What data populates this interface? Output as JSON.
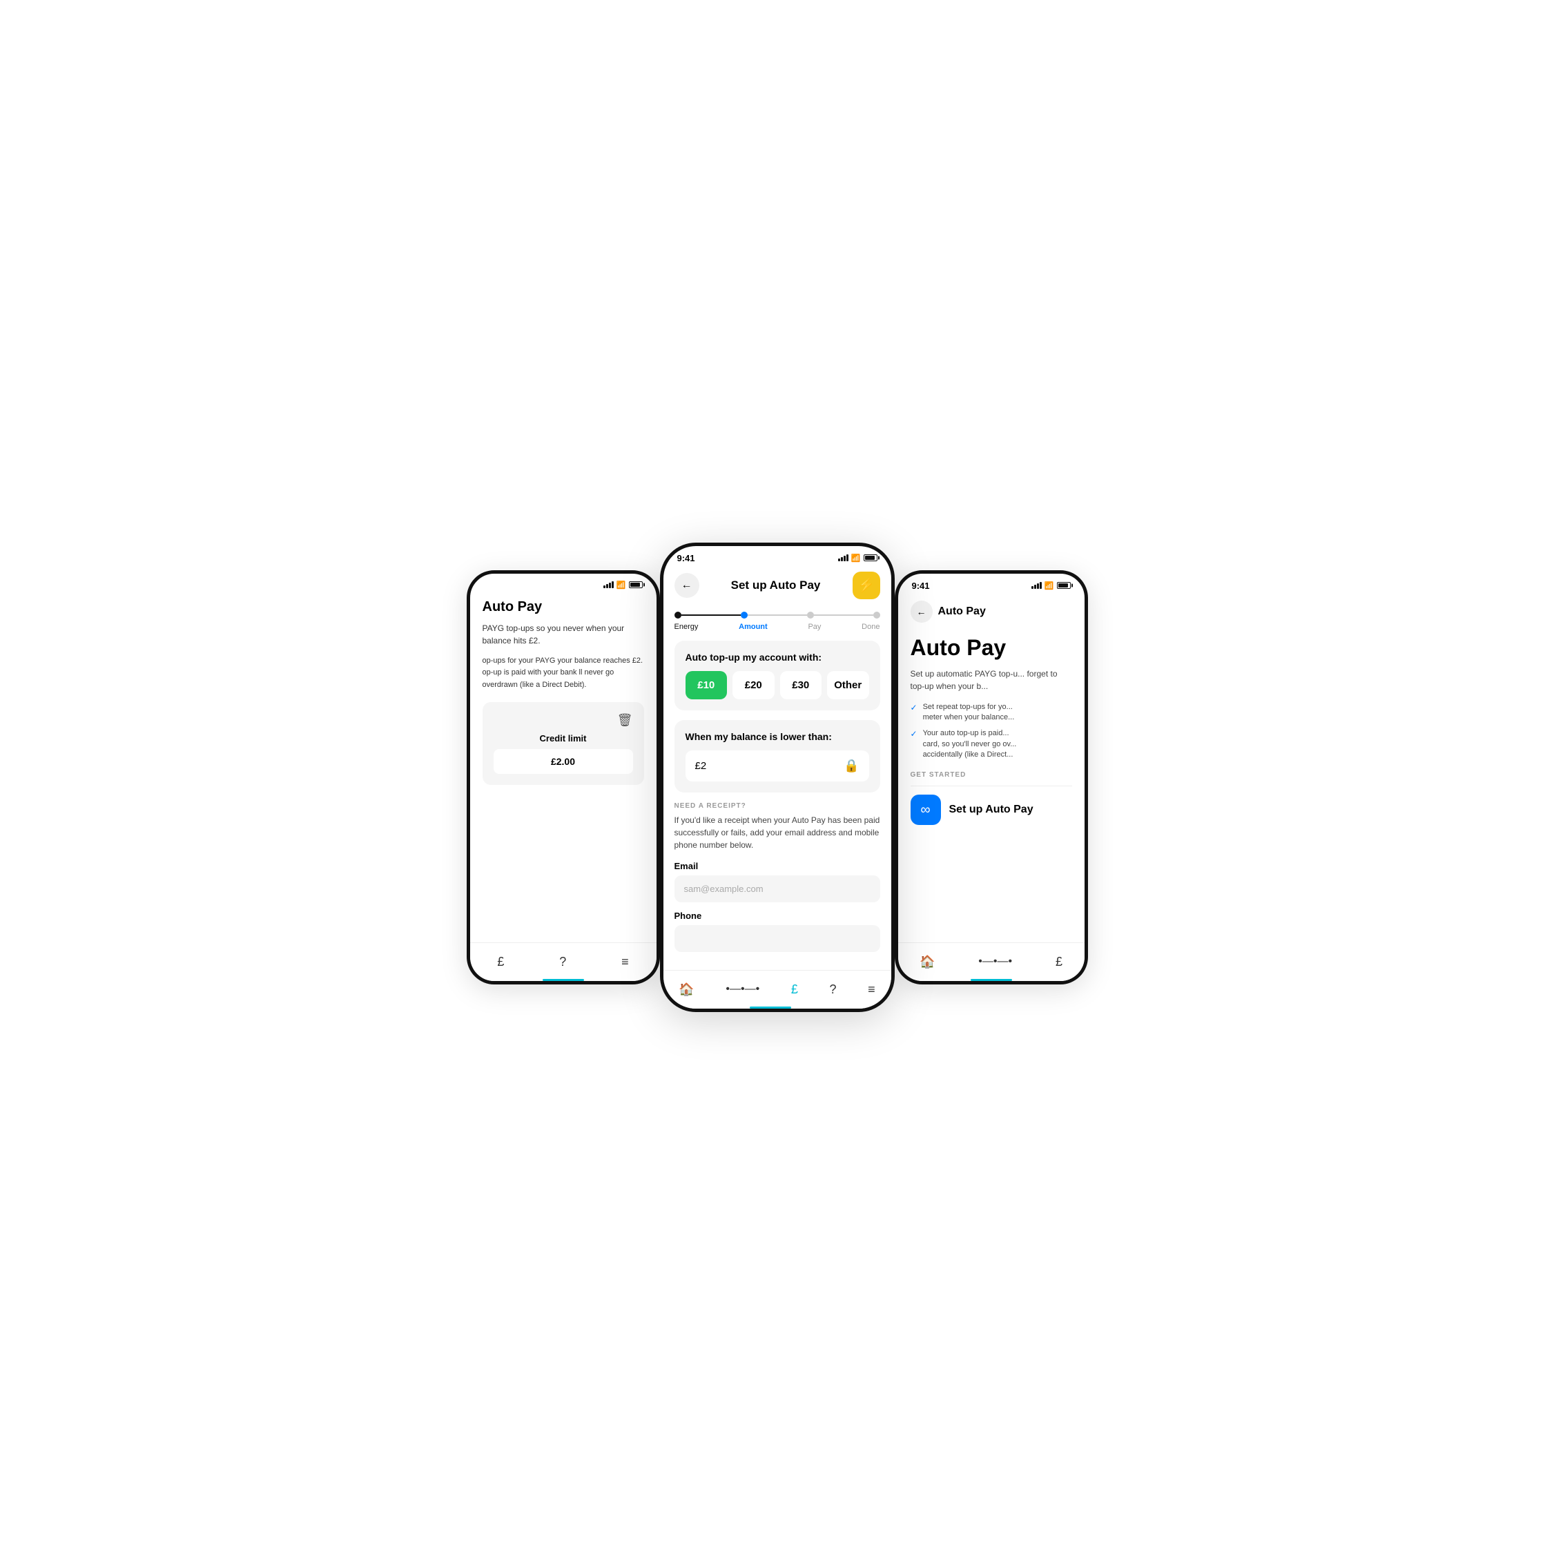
{
  "left": {
    "title": "Auto Pay",
    "desc": "PAYG top-ups so you never\nwhen your balance hits £2.",
    "bullets": "op-ups for your PAYG\nyour balance reaches £2.\n\nop-up is paid with your bank\nll never go overdrawn\n(like a Direct Debit).",
    "card": {
      "credit_label": "Credit limit",
      "credit_value": "£2.00"
    },
    "nav": [
      "£",
      "?",
      "≡"
    ]
  },
  "center": {
    "time": "9:41",
    "header": {
      "back_label": "←",
      "title": "Set up Auto Pay",
      "lightning": "⚡"
    },
    "steps": [
      {
        "label": "Energy",
        "state": "filled"
      },
      {
        "label": "Amount",
        "state": "active"
      },
      {
        "label": "Pay",
        "state": "default"
      },
      {
        "label": "Done",
        "state": "default"
      }
    ],
    "amount_section": {
      "title": "Auto top-up my account with:",
      "options": [
        {
          "label": "£10",
          "selected": true
        },
        {
          "label": "£20",
          "selected": false
        },
        {
          "label": "£30",
          "selected": false
        },
        {
          "label": "Other",
          "selected": false
        }
      ]
    },
    "balance_section": {
      "title": "When my balance is lower than:",
      "value": "£2",
      "lock_icon": "🔒"
    },
    "receipt_section": {
      "label": "NEED A RECEIPT?",
      "desc": "If you'd like a receipt when your Auto Pay has been paid successfully or fails, add your email address and mobile phone number below.",
      "email_label": "Email",
      "email_placeholder": "sam@example.com",
      "phone_label": "Phone"
    },
    "nav": [
      "🏠",
      "⋯",
      "£",
      "?",
      "≡"
    ],
    "nav_active_index": 2
  },
  "right": {
    "time": "9:41",
    "back_label": "←",
    "page_title": "Auto Pay",
    "main_title": "Auto Pay",
    "desc": "Set up automatic PAYG top-u...\nforget to top-up when your b...",
    "bullets": [
      "Set repeat top-ups for yo...\nmeter when your balance...",
      "Your auto top-up is paid...\ncard, so you'll never go ov...\naccidentally (like a Direct..."
    ],
    "get_started_label": "GET STARTED",
    "setup_btn_label": "Set up Auto Pay",
    "setup_btn_icon": "∞",
    "nav": [
      "🏠",
      "⋯",
      "£"
    ]
  }
}
